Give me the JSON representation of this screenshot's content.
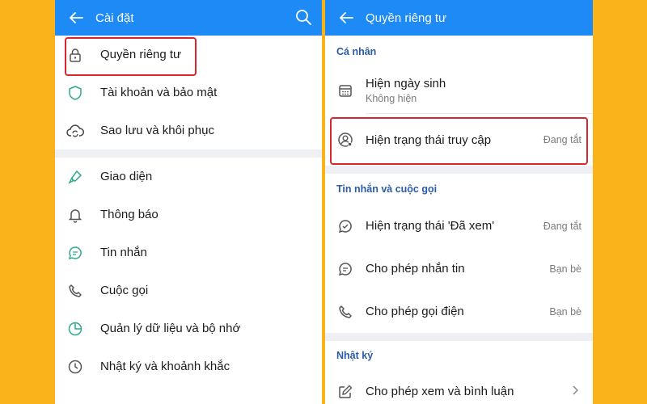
{
  "colors": {
    "background": "#fbb31c",
    "header": "#1e8af5",
    "highlight": "#d7262e",
    "section": "#2b5aa6"
  },
  "left": {
    "title": "Cài đặt",
    "items": [
      {
        "label": "Quyền riêng tư",
        "icon": "lock-icon"
      },
      {
        "label": "Tài khoản và bảo mật",
        "icon": "shield-icon"
      },
      {
        "label": "Sao lưu và khôi phục",
        "icon": "cloud-sync-icon"
      },
      {
        "label": "Giao diện",
        "icon": "brush-icon"
      },
      {
        "label": "Thông báo",
        "icon": "bell-icon"
      },
      {
        "label": "Tin nhắn",
        "icon": "chat-icon"
      },
      {
        "label": "Cuộc gọi",
        "icon": "phone-icon"
      },
      {
        "label": "Quản lý dữ liệu và bộ nhớ",
        "icon": "pie-chart-icon"
      },
      {
        "label": "Nhật ký và khoảnh khắc",
        "icon": "clock-icon"
      }
    ]
  },
  "right": {
    "title": "Quyền riêng tư",
    "sections": [
      {
        "label": "Cá nhân"
      },
      {
        "label": "Tin nhắn và cuộc gọi"
      },
      {
        "label": "Nhật ký"
      }
    ],
    "rows": [
      {
        "label": "Hiện ngày sinh",
        "sub": "Không hiện",
        "icon": "calendar-icon"
      },
      {
        "label": "Hiện trạng thái truy cập",
        "value": "Đang tắt",
        "icon": "user-status-icon"
      },
      {
        "label": "Hiện trạng thái 'Đã xem'",
        "value": "Đang tắt",
        "icon": "seen-icon"
      },
      {
        "label": "Cho phép nhắn tin",
        "value": "Bạn bè",
        "icon": "chat-icon"
      },
      {
        "label": "Cho phép gọi điện",
        "value": "Bạn bè",
        "icon": "phone-icon"
      },
      {
        "label": "Cho phép xem và bình luận",
        "icon": "edit-icon"
      }
    ]
  }
}
